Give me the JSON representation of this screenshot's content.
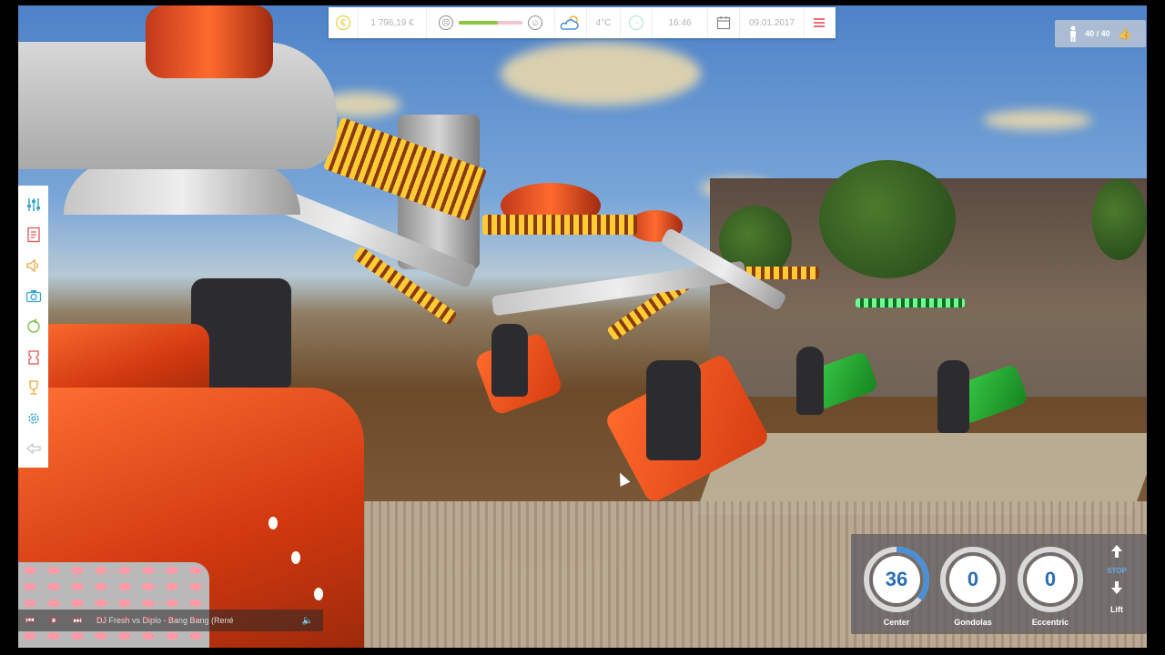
{
  "hud": {
    "money": "1 796,19 €",
    "satisfaction_level": 0.62,
    "temperature": "4°C",
    "time": "16:46",
    "date": "09.01.2017",
    "icons": [
      "coin-icon",
      "sad-face-icon",
      "happy-face-icon",
      "weather-partly-cloudy-icon",
      "clock-icon",
      "calendar-icon",
      "menu-icon"
    ]
  },
  "visitors": {
    "count": "40 / 40"
  },
  "left_toolbar": {
    "items": [
      "sliders-icon",
      "checklist-icon",
      "speaker-icon",
      "camera-icon",
      "recycle-icon",
      "ticket-icon",
      "trophy-icon",
      "gear-icon",
      "back-arrow-icon"
    ]
  },
  "ride_panel": {
    "gauges": [
      {
        "label": "Center",
        "value": "36",
        "fraction": 0.36
      },
      {
        "label": "Gondolas",
        "value": "0",
        "fraction": 0
      },
      {
        "label": "Eccentric",
        "value": "0",
        "fraction": 0
      }
    ],
    "stop_label": "STOP",
    "lift_label": "Lift"
  },
  "player": {
    "track": "DJ Fresh vs Diplo - Bang Bang (René",
    "buttons": [
      "previous-icon",
      "pause-icon",
      "next-icon",
      "volume-icon"
    ]
  },
  "colors": {
    "accent_blue": "#2b6db4",
    "satisfaction_green": "#8cc63f",
    "menu_red": "#e7374a",
    "coin_yellow": "#e9c21a"
  }
}
